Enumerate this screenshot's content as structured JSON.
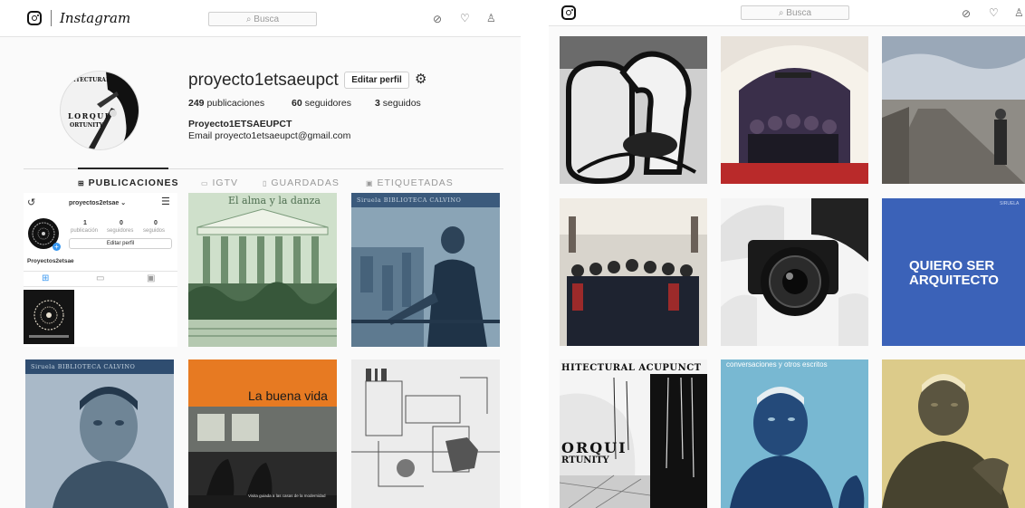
{
  "left": {
    "brand": "Instagram",
    "search_placeholder": "⌕ Busca",
    "profile": {
      "username": "proyecto1etsaeupct",
      "edit_label": "Editar perfil",
      "posts_count": "249",
      "posts_label": " publicaciones",
      "followers_count": "60",
      "followers_label": " seguidores",
      "following_count": "3",
      "following_label": " seguidos",
      "full_name": "Proyecto1ETSAEUPCT",
      "bio": "Email proyecto1etsaeupct@gmail.com",
      "avatar_text_top": "ITECTURAL",
      "avatar_text_mid": "LORQUI",
      "avatar_text_bot": "ORTUNITY"
    },
    "tabs": [
      {
        "icon": "⊞",
        "label": "PUBLICACIONES"
      },
      {
        "icon": "▭",
        "label": "IGTV"
      },
      {
        "icon": "▯",
        "label": "GUARDADAS"
      },
      {
        "icon": "▣",
        "label": "ETIQUETADAS"
      }
    ],
    "embedded_profile": {
      "username": "proyectos2etsae ⌄",
      "posts_count": "1",
      "posts_label": "publicación",
      "followers_count": "0",
      "followers_label": "seguidores",
      "following_count": "0",
      "following_label": "seguidos",
      "edit_label": "Editar perfil",
      "display_name": "Proyectos2etsae"
    },
    "posts": [
      {
        "title": "El alma y la danza"
      },
      {
        "header": "Siruela   BIBLIOTECA CALVINO"
      },
      {
        "header": "Siruela   BIBLIOTECA CALVINO"
      },
      {
        "title": "La buena vida",
        "subtitle": "Visita guiada a las casas de la modernidad"
      },
      {
        "title": ""
      }
    ]
  },
  "right": {
    "search_placeholder": "⌕ Busca",
    "posts": [
      {
        "title": ""
      },
      {
        "title": ""
      },
      {
        "title": ""
      },
      {
        "title": ""
      },
      {
        "title": ""
      },
      {
        "title": "QUIERO SER\nARQUITECTO",
        "line1": "QUIERO SER",
        "line2": "ARQUITECTO",
        "corner": "SIRUELA"
      },
      {
        "line1": "HITECTURAL ACUPUNCT",
        "line2": "ORQUI",
        "line3": "RTUNITY"
      },
      {
        "header": "conversaciones y otros escritos"
      },
      {
        "title": ""
      }
    ]
  },
  "colors": {
    "accent_blue": "#3897f0",
    "text": "#262626",
    "muted": "#999999",
    "border": "#dbdbdb",
    "quiero_blue": "#3b62b8"
  }
}
